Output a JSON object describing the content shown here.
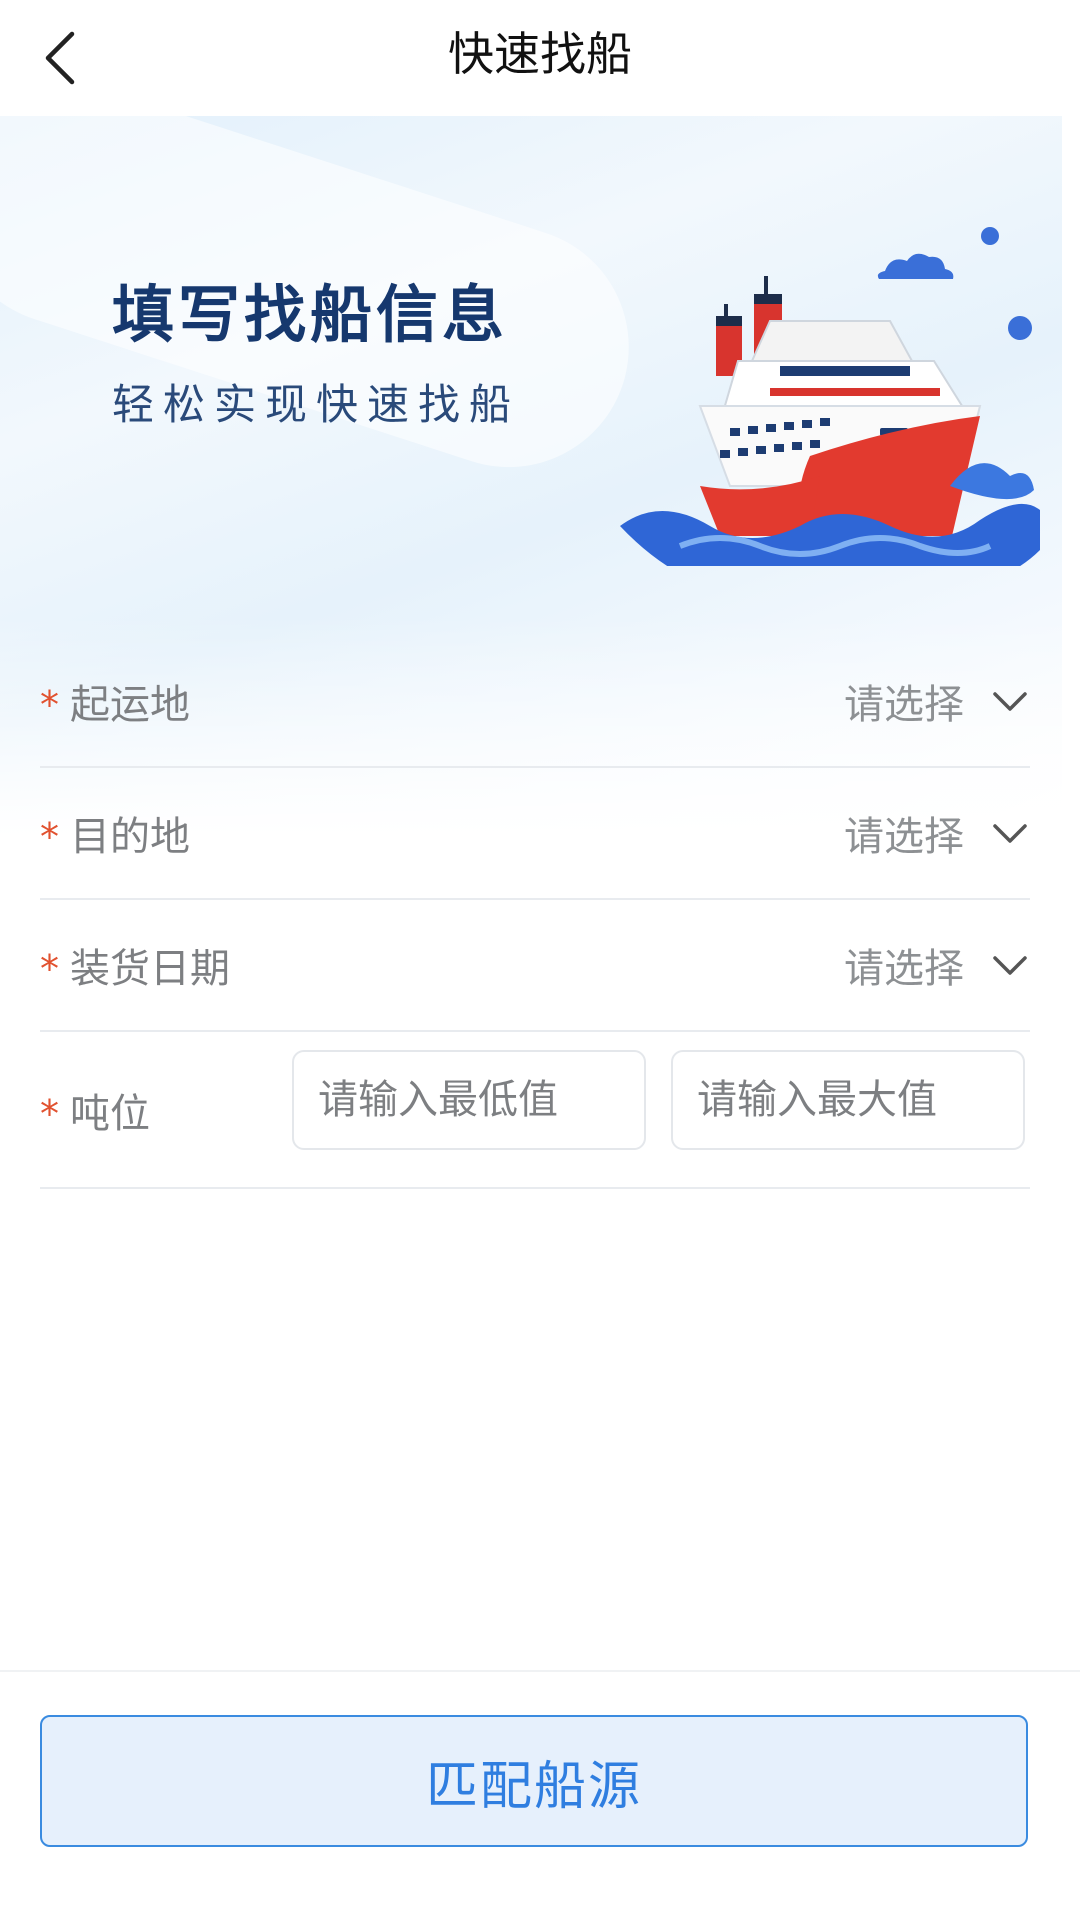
{
  "header": {
    "title": "快速找船",
    "back_icon": "chevron-left-icon"
  },
  "banner": {
    "title": "填写找船信息",
    "subtitle": "轻松实现快速找船",
    "illustration": "cruise-ship-illustration"
  },
  "form": {
    "required_mark": "*",
    "fields": [
      {
        "label": "起运地",
        "placeholder": "请选择"
      },
      {
        "label": "目的地",
        "placeholder": "请选择"
      },
      {
        "label": "装货日期",
        "placeholder": "请选择"
      }
    ],
    "tonnage": {
      "label": "吨位",
      "min_placeholder": "请输入最低值",
      "max_placeholder": "请输入最大值"
    }
  },
  "footer": {
    "submit_label": "匹配船源"
  },
  "colors": {
    "required": "#e1512f",
    "accent": "#2f7ee0",
    "button_bg": "#e6f0fc",
    "banner_title": "#16386e"
  }
}
